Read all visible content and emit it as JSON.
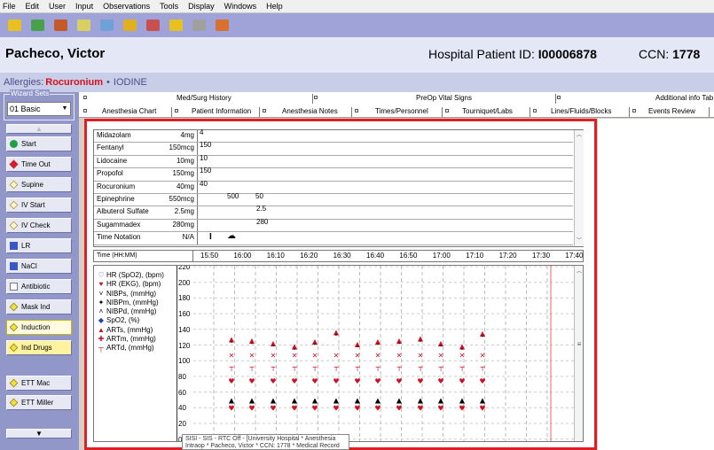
{
  "menu": [
    "File",
    "Edit",
    "User",
    "Input",
    "Observations",
    "Tools",
    "Display",
    "Windows",
    "Help"
  ],
  "toolbar_icons": [
    {
      "name": "open-folder-icon",
      "color": "#e8c020"
    },
    {
      "name": "back-arrow-icon",
      "color": "#49a04a"
    },
    {
      "name": "people-icon",
      "color": "#c45a2a"
    },
    {
      "name": "pen-icon",
      "color": "#d8d060"
    },
    {
      "name": "calc-icon",
      "color": "#70a0d8"
    },
    {
      "name": "folder-search-icon",
      "color": "#e0b020"
    },
    {
      "name": "person-icon",
      "color": "#c85050"
    },
    {
      "name": "folder-icon",
      "color": "#e8c020"
    },
    {
      "name": "building-icon",
      "color": "#a0a0a0"
    },
    {
      "name": "group-icon",
      "color": "#d87030"
    }
  ],
  "patient": {
    "name": "Pacheco, Victor",
    "hospital_id_label": "Hospital Patient ID: ",
    "hospital_id": "I00006878",
    "ccn_label": "CCN: ",
    "ccn": "1778"
  },
  "allergies": {
    "label": "Allergies:",
    "primary": "Rocuronium",
    "separator": "•",
    "secondary": "IODINE"
  },
  "wizard": {
    "title": "Wizard Sets",
    "selected_set": "01 Basic",
    "buttons": [
      {
        "label": "Start",
        "icon": "ic-circle"
      },
      {
        "label": "Time Out",
        "icon": "ic-diamond-red"
      },
      {
        "label": "Supine",
        "icon": "ic-diamond-empty"
      },
      {
        "label": "IV Start",
        "icon": "ic-diamond-empty"
      },
      {
        "label": "IV Check",
        "icon": "ic-diamond-empty"
      },
      {
        "label": "LR",
        "icon": "ic-sq-blue"
      },
      {
        "label": "NaCl",
        "icon": "ic-sq-blue"
      },
      {
        "label": "Antibiotic",
        "icon": "ic-sq-empty"
      },
      {
        "label": "Mask Ind",
        "icon": "ic-diamond-yel"
      },
      {
        "label": "Induction",
        "icon": "ic-diamond-yel"
      },
      {
        "label": "Ind Drugs",
        "icon": "ic-diamond-yel"
      },
      {
        "label": "ETT Mac",
        "icon": "ic-diamond-yel"
      },
      {
        "label": "ETT Miller",
        "icon": "ic-diamond-yel"
      }
    ]
  },
  "tabs_top": [
    "Med/Surg History",
    "PreOp Vital Signs",
    "Additional info Tab"
  ],
  "tabs_bottom": [
    "Anesthesia Chart",
    "Patient Information",
    "Anesthesia Notes",
    "Times/Personnel",
    "Tourniquet/Labs",
    "Lines/Fluids/Blocks",
    "Events Review"
  ],
  "medications": [
    {
      "name": "Midazolam",
      "dose": "4mg",
      "marks": [
        "4"
      ]
    },
    {
      "name": "Fentanyl",
      "dose": "150mcg",
      "marks": [
        "150"
      ]
    },
    {
      "name": "Lidocaine",
      "dose": "10mg",
      "marks": [
        "10"
      ]
    },
    {
      "name": "Propofol",
      "dose": "150mg",
      "marks": [
        "150"
      ]
    },
    {
      "name": "Rocuronium",
      "dose": "40mg",
      "marks": [
        "40"
      ]
    },
    {
      "name": "Epinephrine",
      "dose": "550mcg",
      "marks": [
        "500",
        "50"
      ]
    },
    {
      "name": "Albuterol Sulfate",
      "dose": "2.5mg",
      "marks": [
        "2.5"
      ]
    },
    {
      "name": "Sugammadex",
      "dose": "280mg",
      "marks": [
        "280"
      ]
    },
    {
      "name": "Time Notation",
      "dose": "N/A",
      "marks": []
    }
  ],
  "time_header": {
    "label": "Time (HH:MM)",
    "ticks": [
      "15:50",
      "16:00",
      "16:10",
      "16:20",
      "16:30",
      "16:40",
      "16:50",
      "17:00",
      "17:10",
      "17:20",
      "17:30",
      "17:40"
    ]
  },
  "vitals_legend": [
    {
      "symbol": "♡",
      "color": "#1a3fc0",
      "label": "HR (SpO2), (bpm)"
    },
    {
      "symbol": "♥",
      "color": "#d01020",
      "label": "HR (EKG), (bpm)"
    },
    {
      "symbol": "˅",
      "color": "#000000",
      "label": "NIBPs, (mmHg)"
    },
    {
      "symbol": "✦",
      "color": "#000000",
      "label": "NIBPm, (mmHg)"
    },
    {
      "symbol": "˄",
      "color": "#000000",
      "label": "NIBPd, (mmHg)"
    },
    {
      "symbol": "◆",
      "color": "#1a3fc0",
      "label": "SpO2, (%)"
    },
    {
      "symbol": "▲",
      "color": "#d01020",
      "label": "ARTs, (mmHg)"
    },
    {
      "symbol": "✚",
      "color": "#d01020",
      "label": "ARTm, (mmHg)"
    },
    {
      "symbol": "┬",
      "color": "#d01020",
      "label": "ARTd, (mmHg)"
    }
  ],
  "y_axis_labels": [
    "220",
    "200",
    "180",
    "160",
    "140",
    "120",
    "100",
    "80",
    "60",
    "40",
    "20",
    "0"
  ],
  "status_text": "SISI - SIS - RTC Off - [University Hospital * Anesthesia Intraop * Pacheco, Victor * CCN: 1778 * Medical Record"
}
